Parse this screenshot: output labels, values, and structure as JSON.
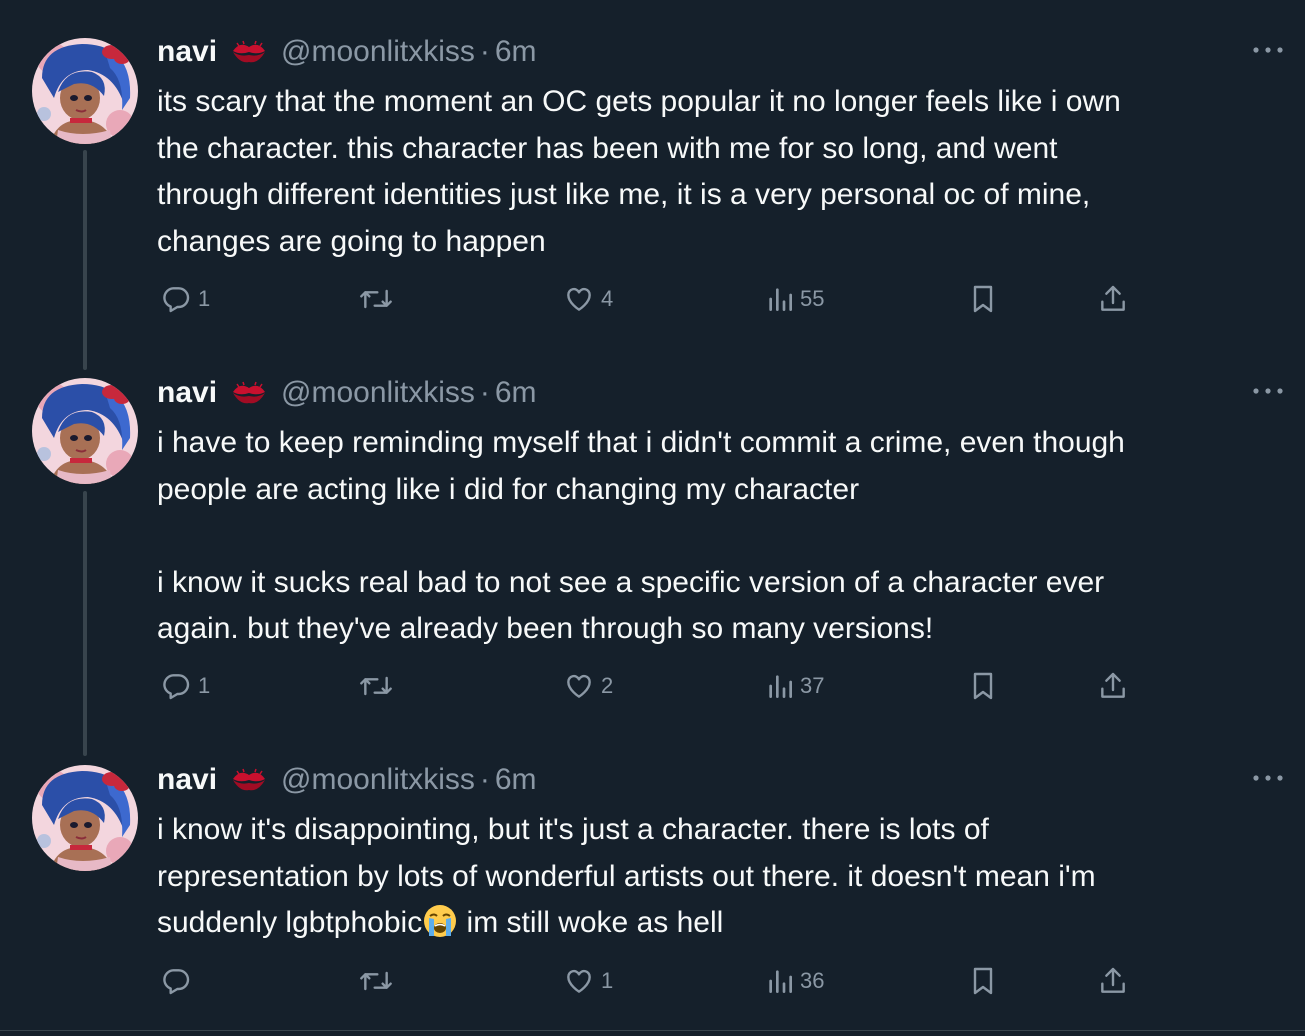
{
  "tweets": [
    {
      "author": {
        "name": "navi",
        "name_emoji": "lips-kiss-emoji",
        "handle": "@moonlitxkiss",
        "separator": "·",
        "time": "6m",
        "avatar": "anime-girl-blue-hair-avatar"
      },
      "text_lines": [
        "its scary that the moment an OC gets popular it no longer feels like i own",
        "the character. this character has been with me for so long, and went",
        "through different identities just like me, it is a very personal oc of mine,",
        "changes are going to happen"
      ],
      "actions": {
        "replies": "1",
        "reposts": "",
        "likes": "4",
        "views": "55"
      }
    },
    {
      "author": {
        "name": "navi",
        "name_emoji": "lips-kiss-emoji",
        "handle": "@moonlitxkiss",
        "separator": "·",
        "time": "6m",
        "avatar": "anime-girl-blue-hair-avatar"
      },
      "text_lines": [
        "i have to keep reminding myself that i didn't commit a crime, even though",
        "people are acting like i did for changing my character",
        "",
        "i know it sucks real bad to not see a specific version of a character ever",
        "again. but they've already been through so many versions!"
      ],
      "actions": {
        "replies": "1",
        "reposts": "",
        "likes": "2",
        "views": "37"
      }
    },
    {
      "author": {
        "name": "navi",
        "name_emoji": "lips-kiss-emoji",
        "handle": "@moonlitxkiss",
        "separator": "·",
        "time": "6m",
        "avatar": "anime-girl-blue-hair-avatar"
      },
      "text_lines": [
        "i know it's disappointing, but it's just a character. there is lots of",
        "representation by lots of wonderful artists out there. it doesn't mean i'm"
      ],
      "last_line_before_emoji": "suddenly lgbtphobic",
      "inline_emoji": "loudly-crying-face-emoji",
      "last_line_after_emoji": " im still woke as hell",
      "actions": {
        "replies": "",
        "reposts": "",
        "likes": "1",
        "views": "36"
      }
    }
  ],
  "icons": {
    "reply": "reply-bubble-icon",
    "repost": "repost-arrows-icon",
    "like": "heart-icon",
    "views": "views-bars-icon",
    "bookmark": "bookmark-icon",
    "share": "share-upload-icon",
    "more": "more-dots-icon"
  },
  "colors": {
    "background": "#15202b",
    "text_primary": "#f7f9f9",
    "text_secondary": "#8b98a5",
    "thread_line": "#38444d"
  }
}
